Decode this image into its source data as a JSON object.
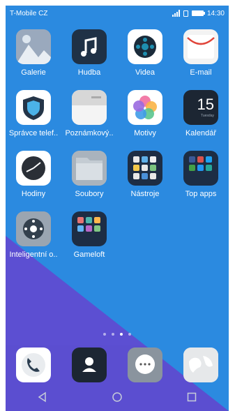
{
  "status_bar": {
    "carrier": "T-Mobile CZ",
    "time": "14:30"
  },
  "colors": {
    "wallpaper_blue": "#2b8ae0",
    "wallpaper_purple": "#5b4ed0"
  },
  "apps": [
    {
      "name": "gallery-app",
      "label": "Galerie",
      "icon": "gallery-icon"
    },
    {
      "name": "music-app",
      "label": "Hudba",
      "icon": "music-note-icon"
    },
    {
      "name": "video-app",
      "label": "Videa",
      "icon": "film-reel-icon"
    },
    {
      "name": "email-app",
      "label": "E-mail",
      "icon": "envelope-icon"
    },
    {
      "name": "phone-manager-app",
      "label": "Správce telef..",
      "icon": "shield-icon"
    },
    {
      "name": "notes-app",
      "label": "Poznámkový..",
      "icon": "notepad-icon"
    },
    {
      "name": "themes-app",
      "label": "Motivy",
      "icon": "flower-icon"
    },
    {
      "name": "calendar-app",
      "label": "Kalendář",
      "icon": "calendar-icon",
      "date_number": "15",
      "day_text": "Tuesday"
    },
    {
      "name": "clock-app",
      "label": "Hodiny",
      "icon": "clock-icon"
    },
    {
      "name": "files-app",
      "label": "Soubory",
      "icon": "folder-icon"
    },
    {
      "name": "tools-folder",
      "label": "Nástroje",
      "icon": "tools-folder-icon"
    },
    {
      "name": "top-apps-folder",
      "label": "Top apps",
      "icon": "top-apps-folder-icon"
    },
    {
      "name": "smart-remote-app",
      "label": "Inteligentní o..",
      "icon": "remote-control-icon"
    },
    {
      "name": "gameloft-folder",
      "label": "Gameloft",
      "icon": "gameloft-folder-icon"
    }
  ],
  "page_indicator": {
    "count": 4,
    "active": 3
  },
  "dock": [
    {
      "name": "dock-phone",
      "icon": "phone-handset-icon"
    },
    {
      "name": "dock-contacts",
      "icon": "contact-person-icon"
    },
    {
      "name": "dock-messages",
      "icon": "message-bubble-icon"
    },
    {
      "name": "dock-browser",
      "icon": "globe-icon"
    }
  ],
  "nav_bar": [
    {
      "name": "back-button",
      "icon": "back-triangle-icon"
    },
    {
      "name": "home-button",
      "icon": "home-circle-icon"
    },
    {
      "name": "recents-button",
      "icon": "recents-square-icon"
    }
  ]
}
